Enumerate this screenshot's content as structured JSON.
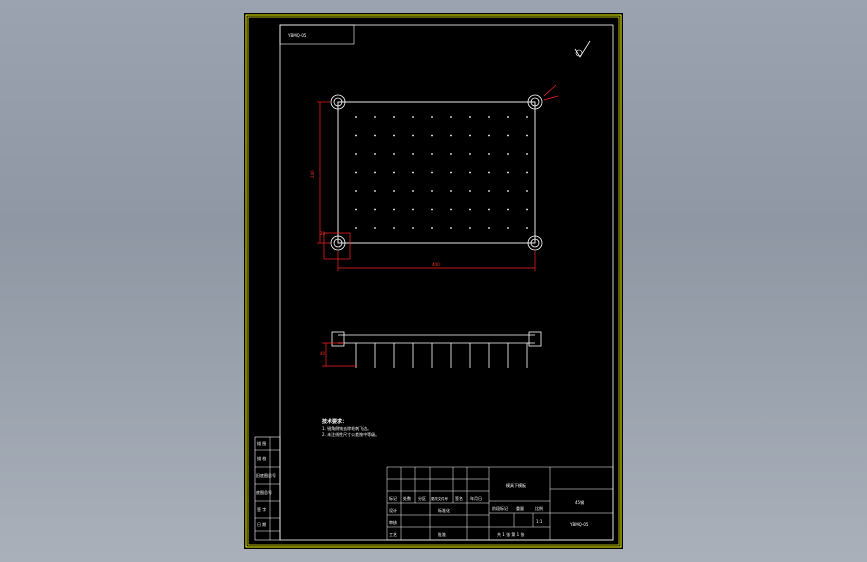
{
  "drawing": {
    "part_name": "模具下模板",
    "tech_requirements_title": "技术要求：",
    "tech_requirements": [
      "1. 锐角倒钝去除毛刺飞边。",
      "2. 未注线性尺寸公差按中等级。"
    ],
    "roughness_symbol": "√",
    "dims": {
      "vertical": "240",
      "horizontal": "400",
      "corner_offset": "20",
      "height": "40"
    }
  },
  "left_strip": {
    "labels": [
      "描 图",
      "描 校",
      "旧底图总号",
      "底图总号",
      "签 字",
      "日 期"
    ]
  },
  "title_block": {
    "header_labels": [
      "标记",
      "处数",
      "分区",
      "更改文件号",
      "签名",
      "年月日"
    ],
    "role_labels": [
      "设计",
      "审核",
      "工艺"
    ],
    "standardization": "标准化",
    "approve": "批准",
    "stage_header": [
      "阶段标记",
      "重量",
      "比例"
    ],
    "scale": "1:1",
    "sheet_info": "共 1 张  第 1 张",
    "part_name": "模具下模板",
    "material": "45钢",
    "drawing_number": "YBMQ-05"
  },
  "colors": {
    "frame": "#ffff00",
    "lines": "#ffffff",
    "dimension": "#ff2020"
  }
}
